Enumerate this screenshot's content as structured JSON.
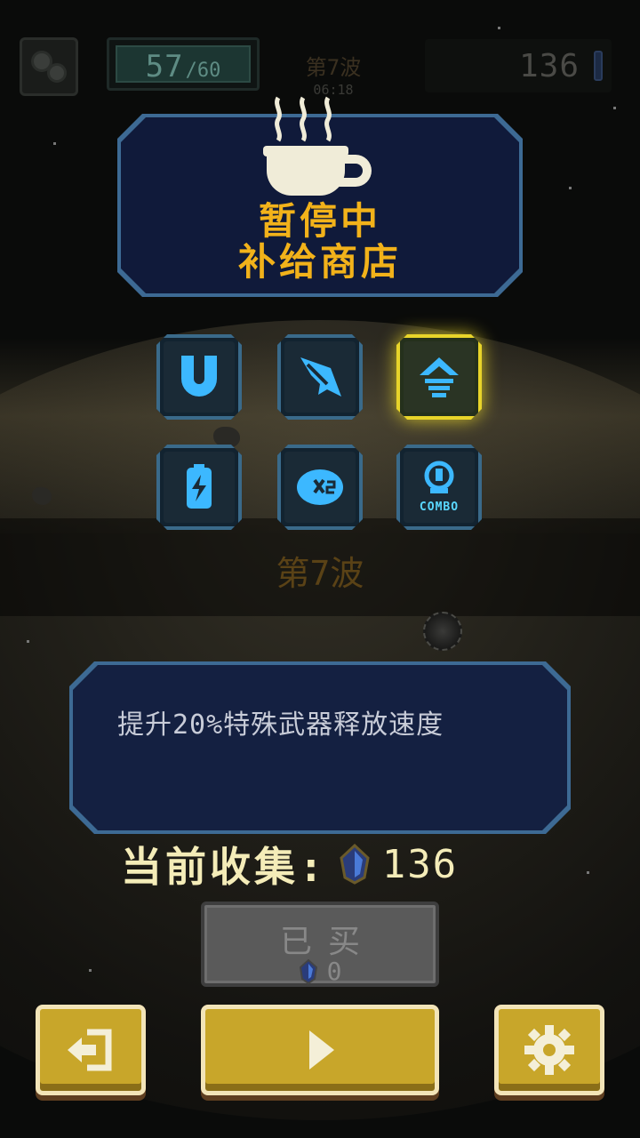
{
  "hud": {
    "hp_current": "57",
    "hp_max": "/60",
    "wave_label": "第7波",
    "timer": "06:18",
    "gem_count": "136"
  },
  "pause": {
    "title_line1": "暂停中",
    "title_line2": "补给商店"
  },
  "powerups": [
    {
      "name": "magnet",
      "icon": "magnet-icon"
    },
    {
      "name": "missile",
      "icon": "missile-icon"
    },
    {
      "name": "fire-rate",
      "icon": "arrow-up-icon",
      "selected": true
    },
    {
      "name": "energy",
      "icon": "battery-icon"
    },
    {
      "name": "double-score",
      "icon": "x2-icon"
    },
    {
      "name": "combo",
      "icon": "combo-icon",
      "label": "COMBO"
    }
  ],
  "wave_banner": "第7波",
  "description": "提升20%特殊武器释放速度",
  "collect": {
    "label": "当前收集:",
    "value": "136"
  },
  "buy_button": {
    "label": "已买",
    "price": "0"
  },
  "colors": {
    "accent_yellow": "#f2b21a",
    "panel_blue": "#101a3a",
    "icon_cyan": "#3cb8ff",
    "button_gold": "#c8a62a"
  }
}
